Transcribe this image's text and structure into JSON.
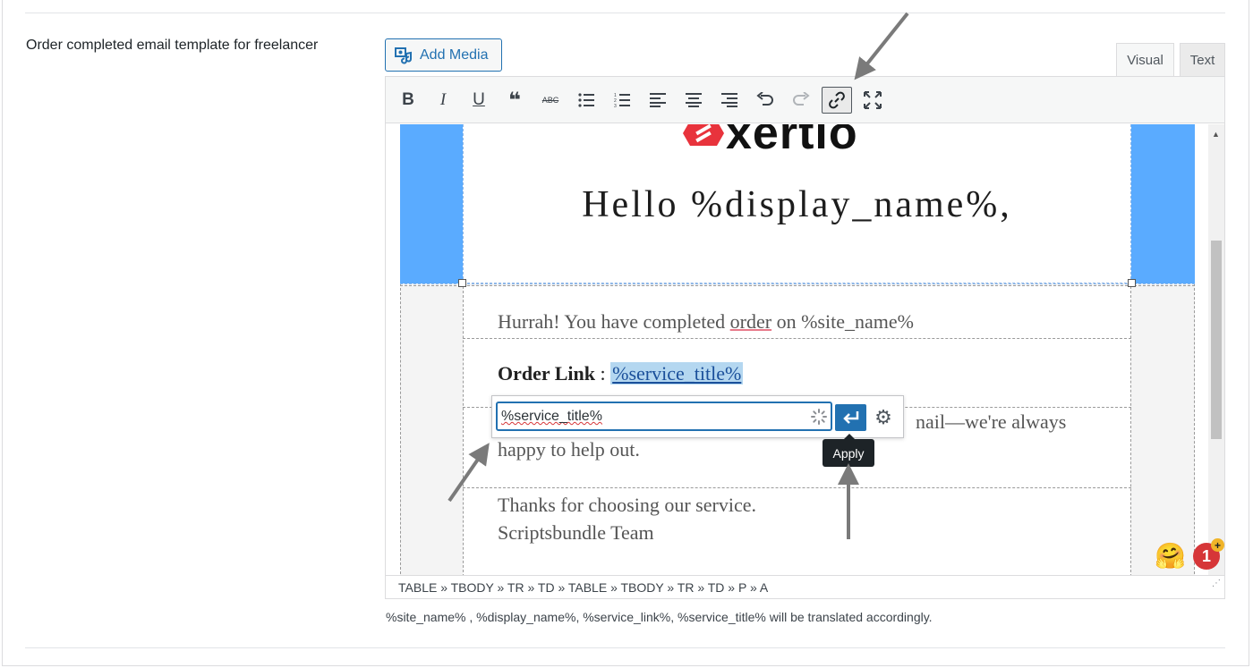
{
  "field": {
    "label": "Order completed email template for freelancer",
    "helper_text": "%site_name% , %display_name%, %service_link%, %service_title% will be translated accordingly."
  },
  "editor": {
    "add_media_label": "Add Media",
    "tabs": [
      {
        "label": "Visual",
        "active": true
      },
      {
        "label": "Text",
        "active": false
      }
    ],
    "toolbar": [
      {
        "name": "bold-button",
        "glyph": "B"
      },
      {
        "name": "italic-button",
        "glyph": "I"
      },
      {
        "name": "underline-button",
        "glyph": "U"
      },
      {
        "name": "blockquote-button",
        "glyph": "❝"
      },
      {
        "name": "strikethrough-button",
        "glyph": "ABC"
      },
      {
        "name": "bullet-list-button",
        "glyph": "☰"
      },
      {
        "name": "numbered-list-button",
        "glyph": "☷"
      },
      {
        "name": "align-left-button",
        "glyph": "≡"
      },
      {
        "name": "align-center-button",
        "glyph": "≡"
      },
      {
        "name": "align-right-button",
        "glyph": "≡"
      },
      {
        "name": "undo-button",
        "glyph": "↶"
      },
      {
        "name": "redo-button",
        "glyph": "↷",
        "disabled": true
      },
      {
        "name": "link-button",
        "glyph": "🔗",
        "active": true
      },
      {
        "name": "fullscreen-button",
        "glyph": "⤢"
      }
    ],
    "status_path": "TABLE » TBODY » TR » TD » TABLE » TBODY » TR » TD » P » A"
  },
  "email": {
    "logo_text": "xertio",
    "greeting": "Hello %display_name%,",
    "line1_prefix": "Hurrah! You have completed ",
    "line1_word": "order",
    "line1_suffix": " on %site_name%",
    "order_link_label": "Order Link",
    "order_link_sep": " : ",
    "order_link_value": "%service_title%",
    "help_line_visible": "nail—we're always",
    "help_line2": "happy to help out.",
    "thanks": "Thanks for choosing our service.",
    "team": "Scriptsbundle Team"
  },
  "link_popup": {
    "input_value": "%service_title%",
    "apply_tooltip": "Apply"
  },
  "notifications": {
    "count": "1",
    "plus": "+"
  },
  "colors": {
    "accent": "#2271b1",
    "banner_blue": "#5aabff",
    "badge_red": "#d63638",
    "logo_red": "#e8333c"
  }
}
